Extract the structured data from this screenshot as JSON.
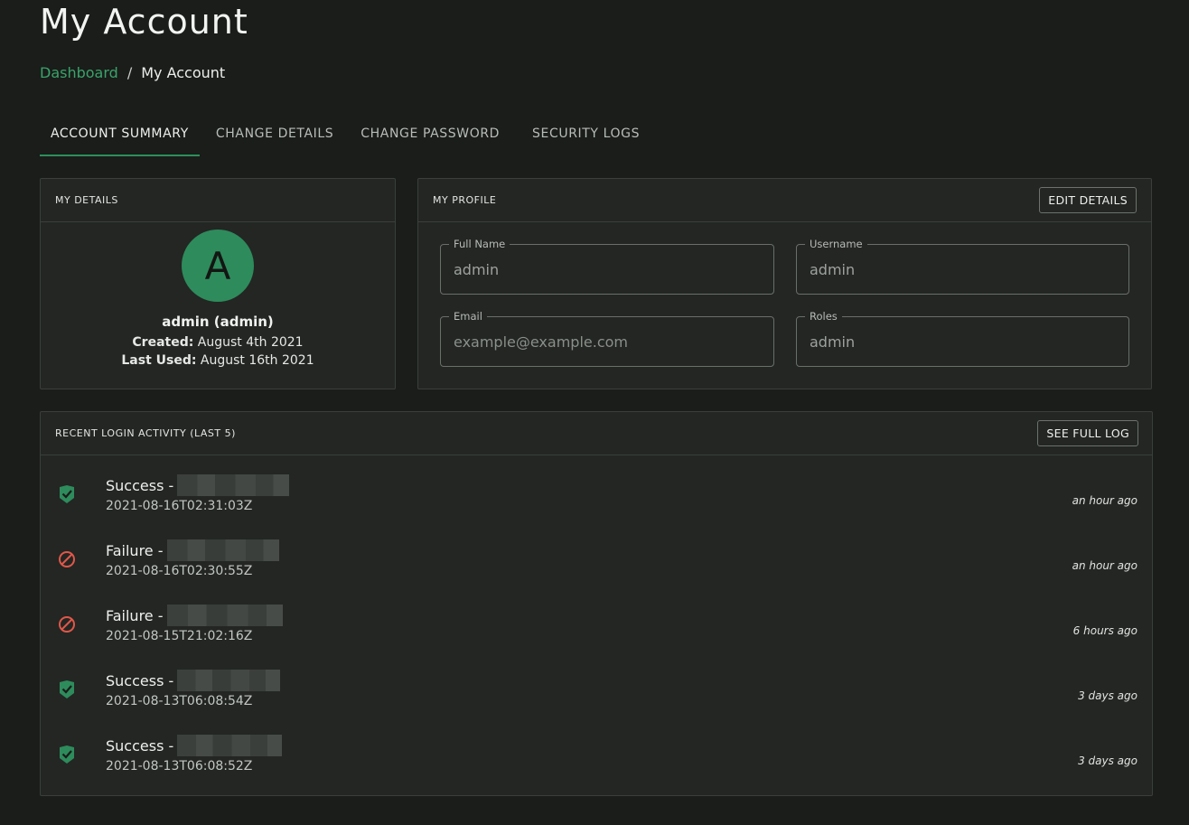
{
  "header": {
    "title": "My Account",
    "breadcrumb": {
      "home": "Dashboard",
      "separator": "/",
      "current": "My Account"
    }
  },
  "tabs": [
    {
      "label": "ACCOUNT SUMMARY",
      "active": true
    },
    {
      "label": "CHANGE DETAILS",
      "active": false
    },
    {
      "label": "CHANGE PASSWORD",
      "active": false
    },
    {
      "label": "SECURITY LOGS",
      "active": false
    }
  ],
  "details": {
    "title": "MY DETAILS",
    "avatar_letter": "A",
    "display_name": "admin (admin)",
    "created_label": "Created:",
    "created_value": "August 4th 2021",
    "last_used_label": "Last Used:",
    "last_used_value": "August 16th 2021"
  },
  "profile": {
    "title": "MY PROFILE",
    "edit_label": "EDIT DETAILS",
    "fields": [
      {
        "label": "Full Name",
        "value": "admin",
        "placeholder": ""
      },
      {
        "label": "Username",
        "value": "admin",
        "placeholder": ""
      },
      {
        "label": "Email",
        "value": "",
        "placeholder": "example@example.com"
      },
      {
        "label": "Roles",
        "value": "admin",
        "placeholder": ""
      }
    ]
  },
  "activity": {
    "title": "RECENT LOGIN ACTIVITY (LAST 5)",
    "full_log_label": "SEE FULL LOG",
    "entries": [
      {
        "status": "Success -",
        "icon": "shield-check-icon",
        "timestamp": "2021-08-16T02:31:03Z",
        "relative": "an hour ago"
      },
      {
        "status": "Failure -",
        "icon": "prohibited-icon",
        "timestamp": "2021-08-16T02:30:55Z",
        "relative": "an hour ago"
      },
      {
        "status": "Failure -",
        "icon": "prohibited-icon",
        "timestamp": "2021-08-15T21:02:16Z",
        "relative": "6 hours ago"
      },
      {
        "status": "Success -",
        "icon": "shield-check-icon",
        "timestamp": "2021-08-13T06:08:54Z",
        "relative": "3 days ago"
      },
      {
        "status": "Success -",
        "icon": "shield-check-icon",
        "timestamp": "2021-08-13T06:08:52Z",
        "relative": "3 days ago"
      }
    ]
  },
  "colors": {
    "accent": "#2e8b5c",
    "success": "#2e8b5c",
    "failure": "#e0574a",
    "background": "#1a1d1a",
    "card": "#232623"
  }
}
